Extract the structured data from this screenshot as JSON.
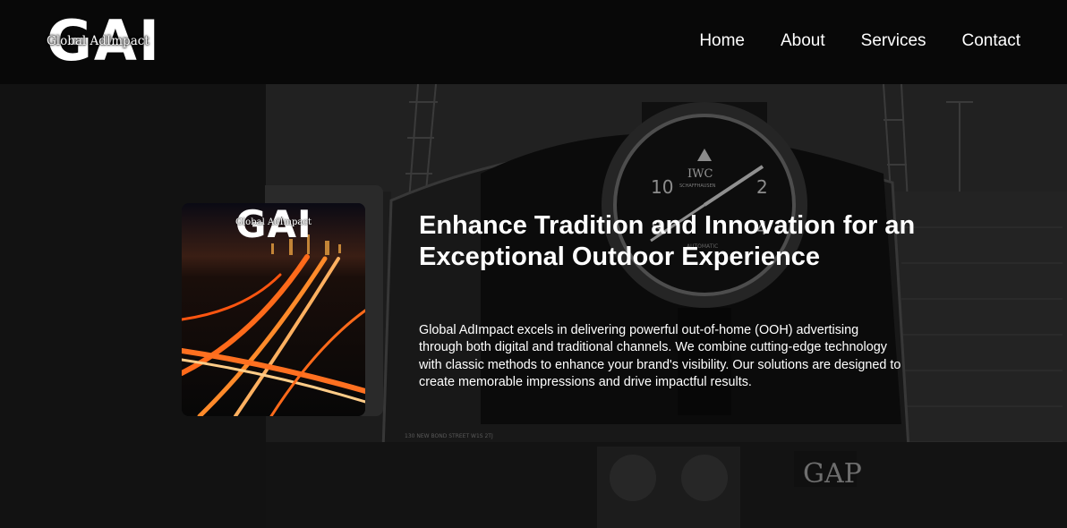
{
  "header": {
    "logo_letters": "GAI",
    "logo_text": "Global AdImpact",
    "nav": [
      {
        "label": "Home"
      },
      {
        "label": "About"
      },
      {
        "label": "Services"
      },
      {
        "label": "Contact"
      }
    ]
  },
  "hero": {
    "title": "Enhance Tradition and Innovation for an Exceptional Outdoor Experience",
    "description": "Global AdImpact excels in delivering powerful out-of-home (OOH) advertising through both digital and traditional channels. We combine cutting-edge technology with classic methods to enhance your brand's visibility. Our solutions are designed to create memorable impressions and drive impactful results.",
    "card_logo_letters": "GAI",
    "card_logo_text": "Global AdImpact",
    "billboard": {
      "brand": "IWC",
      "sub": "SCHAFFHAUSEN",
      "dial_model": "AUTOMATIC",
      "street_text": "130 NEW BOND STREET W1S 2TJ",
      "store_sign": "GAP"
    }
  },
  "colors": {
    "header_bg": "#080808",
    "page_bg": "#121212",
    "card_back": "#2a2a2a",
    "text": "#ffffff",
    "light_trail": "#ff6a1a"
  }
}
